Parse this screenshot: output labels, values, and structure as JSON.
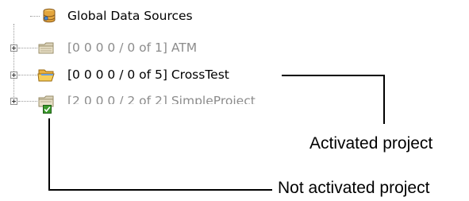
{
  "tree": {
    "root": {
      "label": "Global Data Sources",
      "icon": "database-icon"
    },
    "projects": [
      {
        "label": "[0 0 0 0 / 0 of 1] ATM",
        "icon": "folder-closed-icon",
        "state": "disabled"
      },
      {
        "label": "[0 0 0 0 / 0 of 5] CrossTest",
        "icon": "folder-open-icon",
        "state": "activated"
      },
      {
        "label": "[2 0 0 0 / 2 of 2] SimpleProject",
        "icon": "folder-closed-icon",
        "state": "disabled"
      }
    ]
  },
  "callouts": {
    "activated": "Activated project",
    "not_activated": "Not activated project"
  },
  "colors": {
    "disabled_text": "#8c8c8c",
    "folder_yellow": "#f3c74f",
    "check_green": "#3c9a2c"
  }
}
